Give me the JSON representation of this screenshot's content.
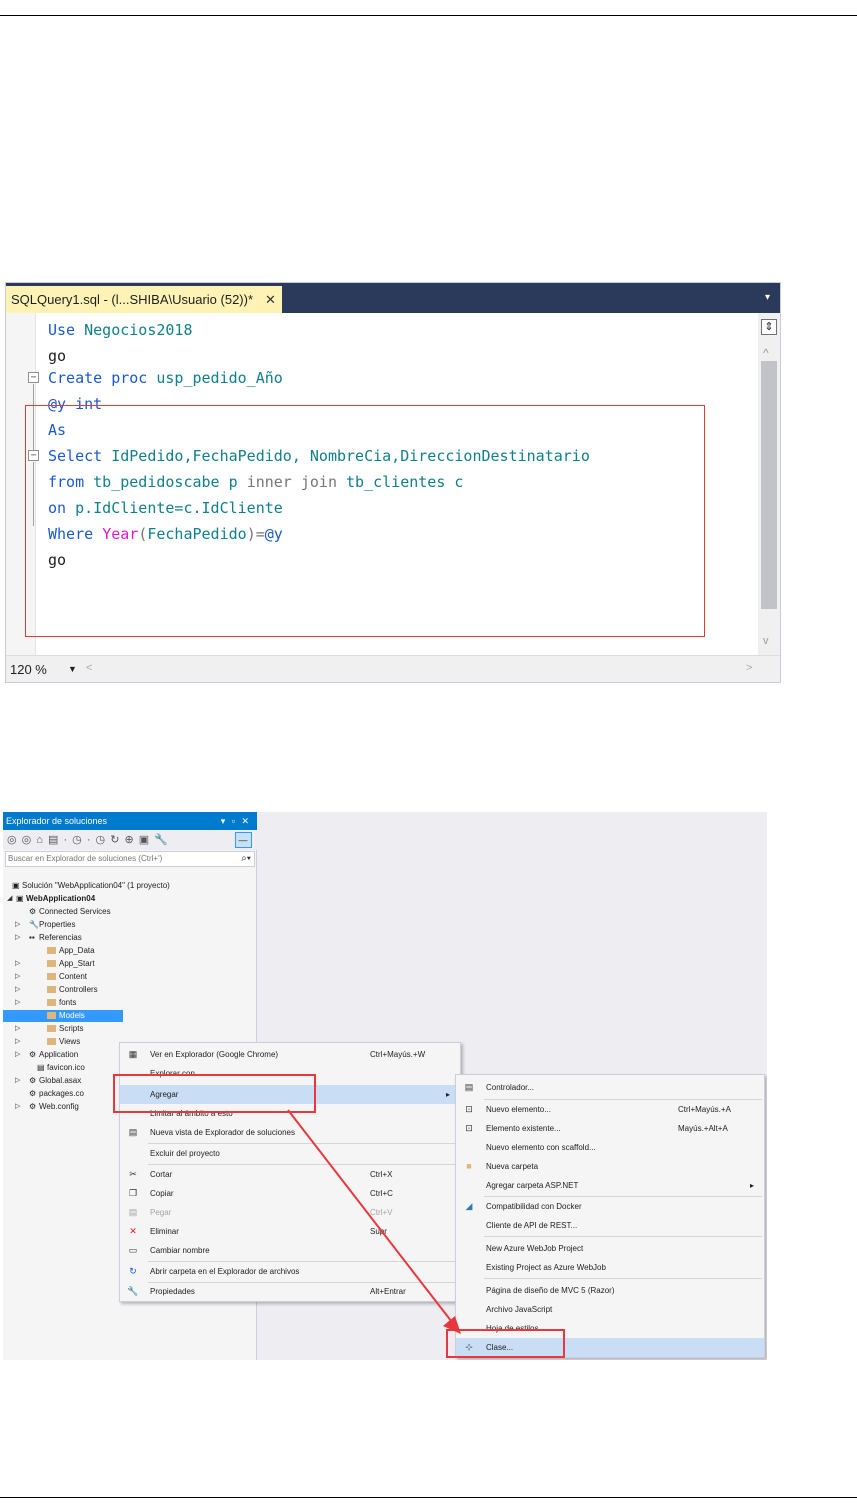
{
  "sql_editor": {
    "tab_title": "SQLQuery1.sql - (l...SHIBA\\Usuario (52))*",
    "tab_close": "✕",
    "dropdown_glyph": "▾",
    "zoom": "120 %",
    "code": {
      "l1_kw": "Use ",
      "l1_id": "Negocios2018",
      "l2": "go",
      "l3_kw": "Create proc ",
      "l3_id": "usp_pedido_Año",
      "l4_kw": "@y int",
      "l5": "As",
      "l6_kw": "Select ",
      "l6_id": "IdPedido,FechaPedido, NombreCia,DireccionDestinatario",
      "l7_kw": "from ",
      "l7_id1": "tb_pedidoscabe p ",
      "l7_g": "inner join ",
      "l7_id2": "tb_clientes c",
      "l8_kw": "on ",
      "l8_id": "p.IdCliente=c.IdCliente",
      "l9_kw": "Where ",
      "l9_fn": "Year",
      "l9_p1": "(",
      "l9_id": "FechaPedido",
      "l9_p2": ")=",
      "l9_kw2": "@y",
      "l10": "go"
    }
  },
  "solution_explorer": {
    "title": "Explorador de soluciones",
    "title_buttons": "▾ ▫ ✕",
    "toolbar_glyphs": "◎ ◎ ⌂ ▤ · ◷ · ◷ ↻ ⊕ ▣  🔧",
    "search_placeholder": "Buscar en Explorador de soluciones (Ctrl+')",
    "tree": {
      "solution": "Solución \"WebApplication04\" (1 proyecto)",
      "project": "WebApplication04",
      "connected": "Connected Services",
      "properties": "Properties",
      "referencias": "Referencias",
      "app_data": "App_Data",
      "app_start": "App_Start",
      "content": "Content",
      "controllers": "Controllers",
      "fonts": "fonts",
      "models": "Models",
      "scripts": "Scripts",
      "views": "Views",
      "applicationinsights": "Application",
      "favicon": "favicon.ico",
      "global": "Global.asax",
      "packages": "packages.co",
      "webconfig": "Web.config"
    }
  },
  "context_menu": {
    "items": [
      {
        "label": "Ver en Explorador (Google Chrome)",
        "shortcut": "Ctrl+Mayús.+W"
      },
      {
        "label": "Explorar con...",
        "shortcut": ""
      },
      {
        "label": "Agregar",
        "shortcut": "▸"
      },
      {
        "label": "Limitar al ámbito a esto",
        "shortcut": ""
      },
      {
        "label": "Nueva vista de Explorador de soluciones",
        "shortcut": ""
      },
      {
        "label": "Excluir del proyecto",
        "shortcut": ""
      },
      {
        "label": "Cortar",
        "shortcut": "Ctrl+X"
      },
      {
        "label": "Copiar",
        "shortcut": "Ctrl+C"
      },
      {
        "label": "Pegar",
        "shortcut": "Ctrl+V"
      },
      {
        "label": "Eliminar",
        "shortcut": "Supr"
      },
      {
        "label": "Cambiar nombre",
        "shortcut": ""
      },
      {
        "label": "Abrir carpeta en el Explorador de archivos",
        "shortcut": ""
      },
      {
        "label": "Propiedades",
        "shortcut": "Alt+Entrar"
      }
    ]
  },
  "submenu": {
    "items": [
      {
        "label": "Controlador...",
        "shortcut": ""
      },
      {
        "label": "Nuevo elemento...",
        "shortcut": "Ctrl+Mayús.+A"
      },
      {
        "label": "Elemento existente...",
        "shortcut": "Mayús.+Alt+A"
      },
      {
        "label": "Nuevo elemento con scaffold...",
        "shortcut": ""
      },
      {
        "label": "Nueva carpeta",
        "shortcut": ""
      },
      {
        "label": "Agregar carpeta ASP.NET",
        "shortcut": "▸"
      },
      {
        "label": "Compatibilidad con Docker",
        "shortcut": ""
      },
      {
        "label": "Cliente de API de REST...",
        "shortcut": ""
      },
      {
        "label": "New Azure WebJob Project",
        "shortcut": ""
      },
      {
        "label": "Existing Project as Azure WebJob",
        "shortcut": ""
      },
      {
        "label": "Página de diseño de MVC 5 (Razor)",
        "shortcut": ""
      },
      {
        "label": "Archivo JavaScript",
        "shortcut": ""
      },
      {
        "label": "Hoja de estilos",
        "shortcut": ""
      },
      {
        "label": "Clase...",
        "shortcut": ""
      }
    ]
  },
  "colors": {
    "keyword": "#1a58d4",
    "identifier": "#10808a",
    "function": "#e21ad6",
    "annotation_red": "#e8383d",
    "vs_blue": "#007acc"
  }
}
